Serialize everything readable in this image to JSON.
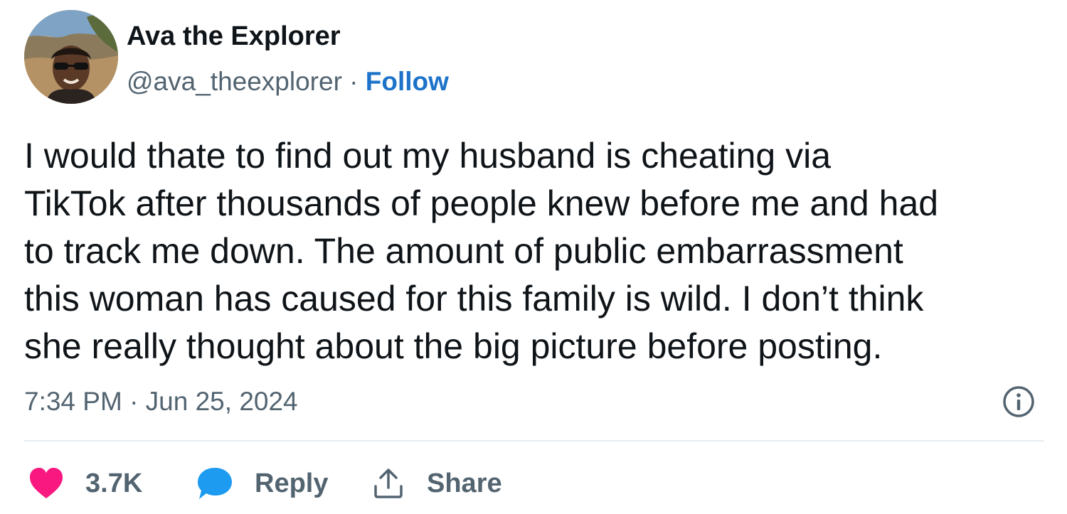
{
  "author": {
    "display_name": "Ava the Explorer",
    "handle": "@ava_theexplorer",
    "separator": " · ",
    "follow_label": "Follow",
    "avatar_icon": "profile-photo"
  },
  "tweet": {
    "lines": [
      "I would thate to find out my husband is cheating via",
      "TikTok after thousands of people knew before me and had",
      "to track me down. The amount of public embarrassment",
      "this woman has caused for this family is wild. I don’t think",
      "she really thought about the big picture before posting."
    ],
    "timestamp": "7:34 PM · Jun 25, 2024"
  },
  "actions": {
    "like_count": "3.7K",
    "reply_label": "Reply",
    "share_label": "Share"
  },
  "colors": {
    "follow": "#1d73c9",
    "like_heart": "#f91880",
    "reply_bubble": "#1d9bf0",
    "secondary_text": "#536471"
  },
  "icons": {
    "info": "info-icon",
    "like": "heart-icon",
    "reply": "speech-bubble-icon",
    "share": "share-icon"
  }
}
